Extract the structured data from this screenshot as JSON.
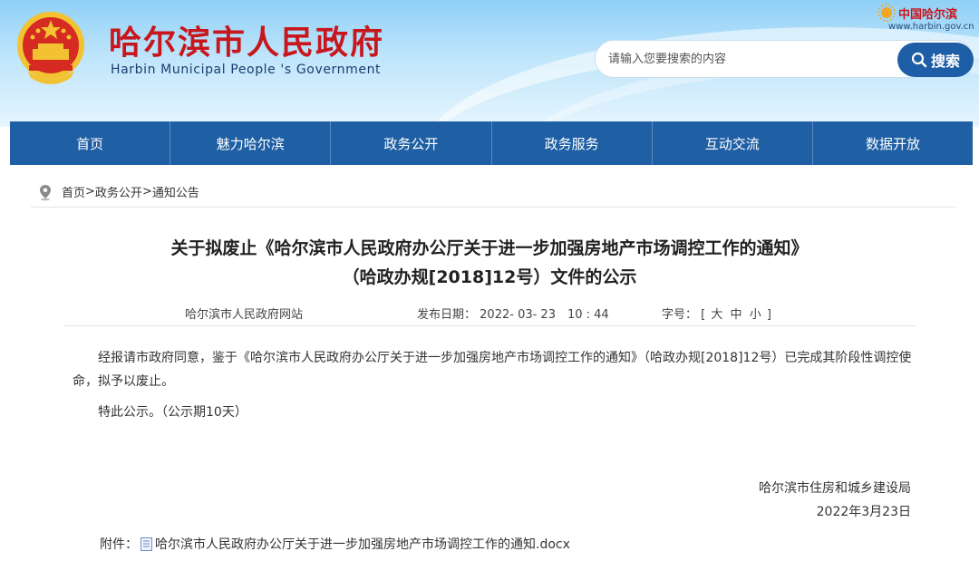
{
  "header": {
    "site_title": "哈尔滨市人民政府",
    "site_subtitle": "Harbin Municipal People 's Government",
    "brand_text": "中国哈尔滨",
    "brand_url": "www.harbin.gov.cn",
    "search_placeholder": "请输入您要搜索的内容",
    "search_button": "搜索"
  },
  "nav": {
    "items": [
      "首页",
      "魅力哈尔滨",
      "政务公开",
      "政务服务",
      "互动交流",
      "数据开放"
    ]
  },
  "breadcrumb": {
    "items": [
      "首页",
      "政务公开",
      "通知公告"
    ],
    "separator": ">"
  },
  "article": {
    "title_line1": "关于拟废止《哈尔滨市人民政府办公厅关于进一步加强房地产市场调控工作的通知》",
    "title_line2": "（哈政办规[2018]12号）文件的公示",
    "source": "哈尔滨市人民政府网站",
    "date_label": "发布日期：",
    "date_value": "2022- 03- 23　10 : 44",
    "fontsize_label": "字号：",
    "fontsize_open": "[",
    "fontsize_large": "大",
    "fontsize_medium": "中",
    "fontsize_small": "小",
    "fontsize_close": "]",
    "paragraph1": "经报请市政府同意，鉴于《哈尔滨市人民政府办公厅关于进一步加强房地产市场调控工作的通知》（哈政办规[2018]12号）已完成其阶段性调控使命，拟予以废止。",
    "paragraph2": "特此公示。（公示期10天）",
    "signer": "哈尔滨市住房和城乡建设局",
    "sign_date": "2022年3月23日",
    "attachment_label": "附件：",
    "attachment_name": "哈尔滨市人民政府办公厅关于进一步加强房地产市场调控工作的通知.docx"
  },
  "colors": {
    "brand_red": "#c8161d",
    "nav_blue": "#1f5fa3",
    "search_blue": "#1d5ea6"
  },
  "icons": {
    "emblem": "national-emblem-icon",
    "search": "search-icon",
    "location": "location-pin-icon",
    "document": "document-icon"
  }
}
